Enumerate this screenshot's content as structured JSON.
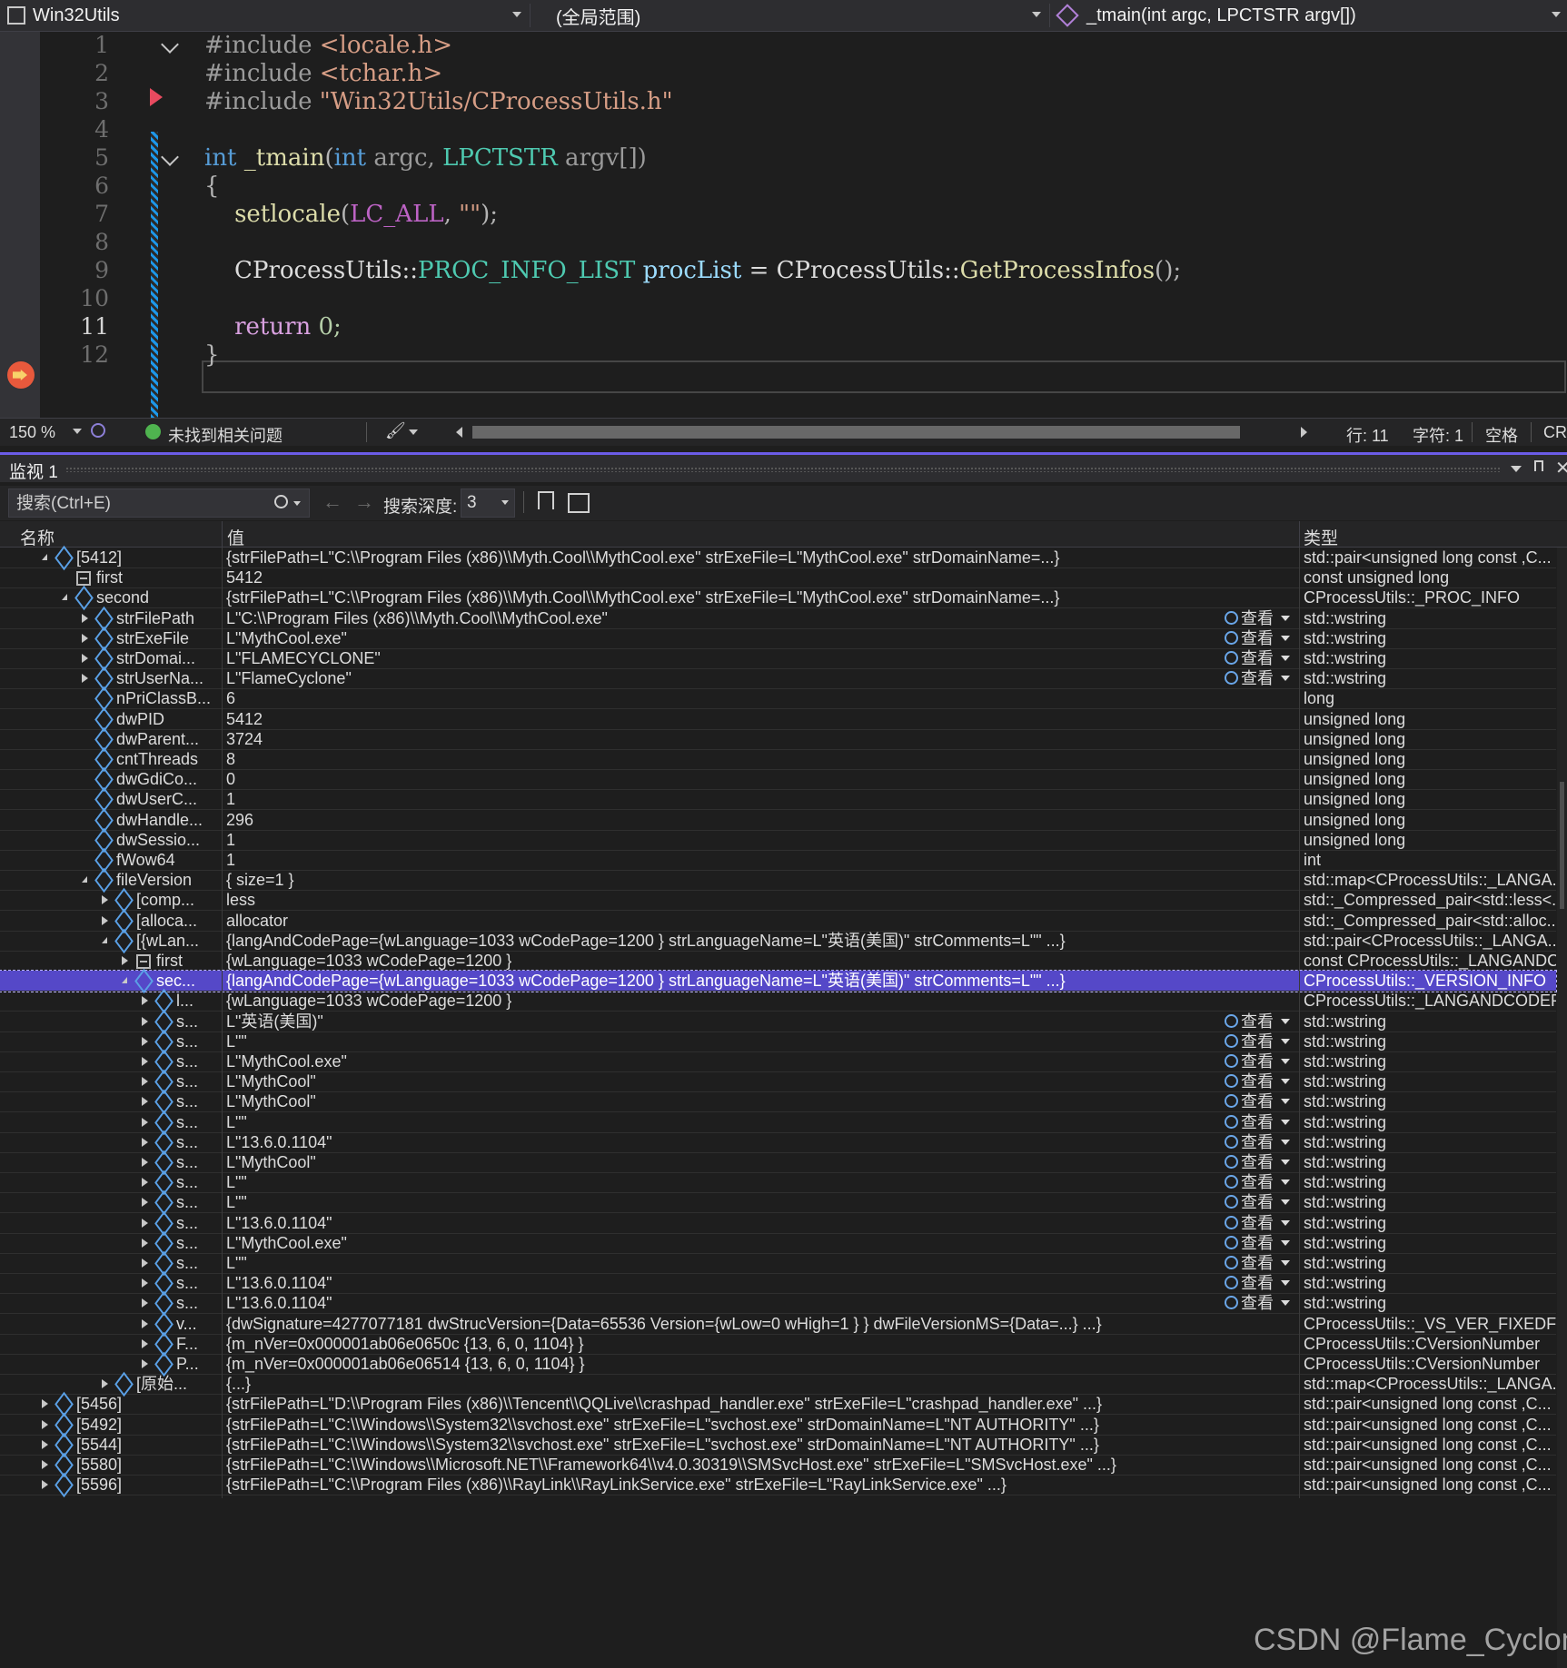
{
  "nav": {
    "project": "Win32Utils",
    "scope": "(全局范围)",
    "function": "_tmain(int argc, LPCTSTR argv[])"
  },
  "editor": {
    "lines": [
      {
        "num": "1",
        "spans": [
          {
            "t": "#include ",
            "c": "#9b9b9b"
          },
          {
            "t": "<locale.h>",
            "c": "#d69d85"
          }
        ]
      },
      {
        "num": "2",
        "spans": [
          {
            "t": "#include ",
            "c": "#9b9b9b"
          },
          {
            "t": "<tchar.h>",
            "c": "#d69d85"
          }
        ]
      },
      {
        "num": "3",
        "spans": [
          {
            "t": "#include ",
            "c": "#9b9b9b"
          },
          {
            "t": "\"Win32Utils/CProcessUtils.h\"",
            "c": "#d69d85"
          }
        ]
      },
      {
        "num": "4",
        "spans": []
      },
      {
        "num": "5",
        "spans": [
          {
            "t": "int",
            "c": "#569cd6"
          },
          {
            "t": " ",
            "c": "#dcdcdc"
          },
          {
            "t": "_tmain",
            "c": "#dcdcaa"
          },
          {
            "t": "(",
            "c": "#b4b4b4"
          },
          {
            "t": "int",
            "c": "#569cd6"
          },
          {
            "t": " argc, ",
            "c": "#9a9a9a"
          },
          {
            "t": "LPCTSTR",
            "c": "#4ec9b0"
          },
          {
            "t": " argv[])",
            "c": "#9a9a9a"
          }
        ]
      },
      {
        "num": "6",
        "spans": [
          {
            "t": "{",
            "c": "#b4b4b4"
          }
        ]
      },
      {
        "num": "7",
        "spans": [
          {
            "t": "    ",
            "c": "#dcdcdc"
          },
          {
            "t": "setlocale",
            "c": "#dcdcaa"
          },
          {
            "t": "(",
            "c": "#b4b4b4"
          },
          {
            "t": "LC_ALL",
            "c": "#bd63c5"
          },
          {
            "t": ", ",
            "c": "#b4b4b4"
          },
          {
            "t": "\"\"",
            "c": "#d69d85"
          },
          {
            "t": ");",
            "c": "#b4b4b4"
          }
        ]
      },
      {
        "num": "8",
        "spans": []
      },
      {
        "num": "9",
        "spans": [
          {
            "t": "    CProcessUtils::",
            "c": "#dcdcdc"
          },
          {
            "t": "PROC_INFO_LIST",
            "c": "#4ec9b0"
          },
          {
            "t": " ",
            "c": "#dcdcdc"
          },
          {
            "t": "procList",
            "c": "#9cdcfe"
          },
          {
            "t": " = CProcessUtils::",
            "c": "#dcdcdc"
          },
          {
            "t": "GetProcessInfos",
            "c": "#dcdcaa"
          },
          {
            "t": "();",
            "c": "#b4b4b4"
          }
        ]
      },
      {
        "num": "10",
        "spans": []
      },
      {
        "num": "11",
        "spans": [
          {
            "t": "    ",
            "c": "#dcdcdc"
          },
          {
            "t": "return",
            "c": "#d8a0df"
          },
          {
            "t": " 0;",
            "c": "#b5cea8"
          }
        ]
      },
      {
        "num": "12",
        "spans": [
          {
            "t": "}",
            "c": "#b4b4b4"
          }
        ]
      }
    ]
  },
  "statusbar": {
    "zoom": "150 %",
    "issues": "未找到相关问题",
    "line": "行: 11",
    "char": "字符: 1",
    "spaces": "空格",
    "crlf": "CRLF"
  },
  "watch": {
    "title": "监视 1",
    "search_placeholder": "搜索(Ctrl+E)",
    "depth_label": "搜索深度:",
    "depth_value": "3",
    "col_name": "名称",
    "col_value": "值",
    "col_type": "类型",
    "view_label": "查看",
    "rows": [
      {
        "d": 1,
        "e": "o",
        "i": "obj",
        "n": "[5412]",
        "v": "{strFilePath=L\"C:\\\\Program Files (x86)\\\\Myth.Cool\\\\MythCool.exe\" strExeFile=L\"MythCool.exe\" strDomainName=...}",
        "t": "std::pair<unsigned long const ,C..."
      },
      {
        "d": 2,
        "e": "",
        "i": "fld",
        "n": "first",
        "v": "5412",
        "t": "const unsigned long"
      },
      {
        "d": 2,
        "e": "o",
        "i": "obj",
        "n": "second",
        "v": "{strFilePath=L\"C:\\\\Program Files (x86)\\\\Myth.Cool\\\\MythCool.exe\" strExeFile=L\"MythCool.exe\" strDomainName=...}",
        "t": "CProcessUtils::_PROC_INFO"
      },
      {
        "d": 3,
        "e": "c",
        "i": "obj",
        "n": "strFilePath",
        "v": "L\"C:\\\\Program Files (x86)\\\\Myth.Cool\\\\MythCool.exe\"",
        "t": "std::wstring",
        "vw": true
      },
      {
        "d": 3,
        "e": "c",
        "i": "obj",
        "n": "strExeFile",
        "v": "L\"MythCool.exe\"",
        "t": "std::wstring",
        "vw": true
      },
      {
        "d": 3,
        "e": "c",
        "i": "obj",
        "n": "strDomai...",
        "v": "L\"FLAMECYCLONE\"",
        "t": "std::wstring",
        "vw": true
      },
      {
        "d": 3,
        "e": "c",
        "i": "obj",
        "n": "strUserNa...",
        "v": "L\"FlameCyclone\"",
        "t": "std::wstring",
        "vw": true
      },
      {
        "d": 3,
        "e": "",
        "i": "obj",
        "n": "nPriClassB...",
        "v": "6",
        "t": "long"
      },
      {
        "d": 3,
        "e": "",
        "i": "obj",
        "n": "dwPID",
        "v": "5412",
        "t": "unsigned long"
      },
      {
        "d": 3,
        "e": "",
        "i": "obj",
        "n": "dwParent...",
        "v": "3724",
        "t": "unsigned long"
      },
      {
        "d": 3,
        "e": "",
        "i": "obj",
        "n": "cntThreads",
        "v": "8",
        "t": "unsigned long"
      },
      {
        "d": 3,
        "e": "",
        "i": "obj",
        "n": "dwGdiCo...",
        "v": "0",
        "t": "unsigned long"
      },
      {
        "d": 3,
        "e": "",
        "i": "obj",
        "n": "dwUserC...",
        "v": "1",
        "t": "unsigned long"
      },
      {
        "d": 3,
        "e": "",
        "i": "obj",
        "n": "dwHandle...",
        "v": "296",
        "t": "unsigned long"
      },
      {
        "d": 3,
        "e": "",
        "i": "obj",
        "n": "dwSessio...",
        "v": "1",
        "t": "unsigned long"
      },
      {
        "d": 3,
        "e": "",
        "i": "obj",
        "n": "fWow64",
        "v": "1",
        "t": "int"
      },
      {
        "d": 3,
        "e": "o",
        "i": "obj",
        "n": "fileVersion",
        "v": "{ size=1 }",
        "t": "std::map<CProcessUtils::_LANGA..."
      },
      {
        "d": 4,
        "e": "c",
        "i": "obj",
        "n": "[comp...",
        "v": "less",
        "t": "std::_Compressed_pair<std::less<..."
      },
      {
        "d": 4,
        "e": "c",
        "i": "obj",
        "n": "[alloca...",
        "v": "allocator",
        "t": "std::_Compressed_pair<std::alloc..."
      },
      {
        "d": 4,
        "e": "o",
        "i": "obj",
        "n": "[{wLan...",
        "v": "{langAndCodePage={wLanguage=1033 wCodePage=1200 } strLanguageName=L\"英语(美国)\" strComments=L\"\" ...}",
        "t": "std::pair<CProcessUtils::_LANGA..."
      },
      {
        "d": 5,
        "e": "c",
        "i": "fld",
        "n": "first",
        "v": "{wLanguage=1033 wCodePage=1200 }",
        "t": "const CProcessUtils::_LANGANDC..."
      },
      {
        "d": 5,
        "e": "o",
        "i": "obj",
        "n": "sec...",
        "v": "{langAndCodePage={wLanguage=1033 wCodePage=1200 } strLanguageName=L\"英语(美国)\" strComments=L\"\" ...}",
        "t": "CProcessUtils::_VERSION_INFO",
        "sel": true
      },
      {
        "d": 6,
        "e": "c",
        "i": "obj",
        "n": "l...",
        "v": "{wLanguage=1033 wCodePage=1200 }",
        "t": "CProcessUtils::_LANGANDCODEP..."
      },
      {
        "d": 6,
        "e": "c",
        "i": "obj",
        "n": "s...",
        "v": "L\"英语(美国)\"",
        "t": "std::wstring",
        "vw": true
      },
      {
        "d": 6,
        "e": "c",
        "i": "obj",
        "n": "s...",
        "v": "L\"\"",
        "t": "std::wstring",
        "vw": true
      },
      {
        "d": 6,
        "e": "c",
        "i": "obj",
        "n": "s...",
        "v": "L\"MythCool.exe\"",
        "t": "std::wstring",
        "vw": true
      },
      {
        "d": 6,
        "e": "c",
        "i": "obj",
        "n": "s...",
        "v": "L\"MythCool\"",
        "t": "std::wstring",
        "vw": true
      },
      {
        "d": 6,
        "e": "c",
        "i": "obj",
        "n": "s...",
        "v": "L\"MythCool\"",
        "t": "std::wstring",
        "vw": true
      },
      {
        "d": 6,
        "e": "c",
        "i": "obj",
        "n": "s...",
        "v": "L\"\"",
        "t": "std::wstring",
        "vw": true
      },
      {
        "d": 6,
        "e": "c",
        "i": "obj",
        "n": "s...",
        "v": "L\"13.6.0.1104\"",
        "t": "std::wstring",
        "vw": true
      },
      {
        "d": 6,
        "e": "c",
        "i": "obj",
        "n": "s...",
        "v": "L\"MythCool\"",
        "t": "std::wstring",
        "vw": true
      },
      {
        "d": 6,
        "e": "c",
        "i": "obj",
        "n": "s...",
        "v": "L\"\"",
        "t": "std::wstring",
        "vw": true
      },
      {
        "d": 6,
        "e": "c",
        "i": "obj",
        "n": "s...",
        "v": "L\"\"",
        "t": "std::wstring",
        "vw": true
      },
      {
        "d": 6,
        "e": "c",
        "i": "obj",
        "n": "s...",
        "v": "L\"13.6.0.1104\"",
        "t": "std::wstring",
        "vw": true
      },
      {
        "d": 6,
        "e": "c",
        "i": "obj",
        "n": "s...",
        "v": "L\"MythCool.exe\"",
        "t": "std::wstring",
        "vw": true
      },
      {
        "d": 6,
        "e": "c",
        "i": "obj",
        "n": "s...",
        "v": "L\"\"",
        "t": "std::wstring",
        "vw": true
      },
      {
        "d": 6,
        "e": "c",
        "i": "obj",
        "n": "s...",
        "v": "L\"13.6.0.1104\"",
        "t": "std::wstring",
        "vw": true
      },
      {
        "d": 6,
        "e": "c",
        "i": "obj",
        "n": "s...",
        "v": "L\"13.6.0.1104\"",
        "t": "std::wstring",
        "vw": true
      },
      {
        "d": 6,
        "e": "c",
        "i": "obj",
        "n": "v...",
        "v": "{dwSignature=4277077181 dwStrucVersion={Data=65536 Version={wLow=0 wHigh=1 } } dwFileVersionMS={Data=...} ...}",
        "t": "CProcessUtils::_VS_VER_FIXEDFILE..."
      },
      {
        "d": 6,
        "e": "c",
        "i": "obj",
        "n": "F...",
        "v": "{m_nVer=0x000001ab06e0650c {13, 6, 0, 1104} }",
        "t": "CProcessUtils::CVersionNumber"
      },
      {
        "d": 6,
        "e": "c",
        "i": "obj",
        "n": "P...",
        "v": "{m_nVer=0x000001ab06e06514 {13, 6, 0, 1104} }",
        "t": "CProcessUtils::CVersionNumber"
      },
      {
        "d": 4,
        "e": "c",
        "i": "obj",
        "n": "[原始...",
        "v": "{...}",
        "t": "std::map<CProcessUtils::_LANGA..."
      },
      {
        "d": 1,
        "e": "c",
        "i": "obj",
        "n": "[5456]",
        "v": "{strFilePath=L\"D:\\\\Program Files (x86)\\\\Tencent\\\\QQLive\\\\crashpad_handler.exe\" strExeFile=L\"crashpad_handler.exe\" ...}",
        "t": "std::pair<unsigned long const ,C..."
      },
      {
        "d": 1,
        "e": "c",
        "i": "obj",
        "n": "[5492]",
        "v": "{strFilePath=L\"C:\\\\Windows\\\\System32\\\\svchost.exe\" strExeFile=L\"svchost.exe\" strDomainName=L\"NT AUTHORITY\" ...}",
        "t": "std::pair<unsigned long const ,C..."
      },
      {
        "d": 1,
        "e": "c",
        "i": "obj",
        "n": "[5544]",
        "v": "{strFilePath=L\"C:\\\\Windows\\\\System32\\\\svchost.exe\" strExeFile=L\"svchost.exe\" strDomainName=L\"NT AUTHORITY\" ...}",
        "t": "std::pair<unsigned long const ,C..."
      },
      {
        "d": 1,
        "e": "c",
        "i": "obj",
        "n": "[5580]",
        "v": "{strFilePath=L\"C:\\\\Windows\\\\Microsoft.NET\\\\Framework64\\\\v4.0.30319\\\\SMSvcHost.exe\" strExeFile=L\"SMSvcHost.exe\" ...}",
        "t": "std::pair<unsigned long const ,C..."
      },
      {
        "d": 1,
        "e": "c",
        "i": "obj",
        "n": "[5596]",
        "v": "{strFilePath=L\"C:\\\\Program Files (x86)\\\\RayLink\\\\RayLinkService.exe\" strExeFile=L\"RayLinkService.exe\" ...}",
        "t": "std::pair<unsigned long const ,C..."
      }
    ]
  },
  "watermark": "CSDN @Flame_Cyclone"
}
